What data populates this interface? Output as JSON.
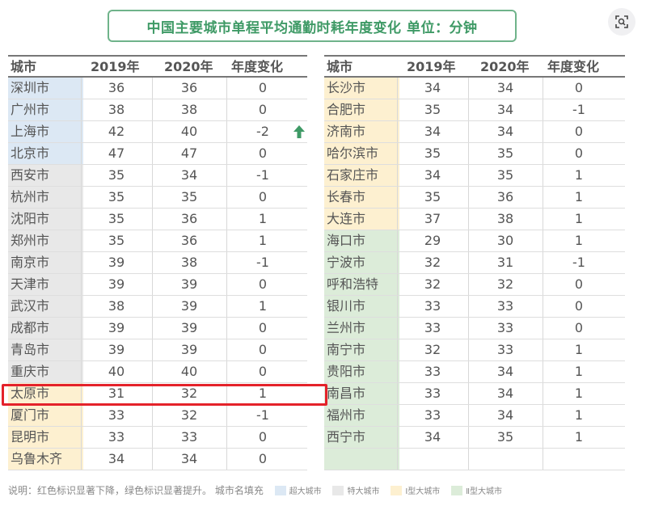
{
  "title": "中国主要城市单程平均通勤时耗年度变化  单位：分钟",
  "headers": [
    "城市",
    "2019年",
    "2020年",
    "年度变化"
  ],
  "colors": {
    "超大城市": "#dce8f4",
    "特大城市": "#e8e8e8",
    "I型大城市": "#fdf0d0",
    "II型大城市": "#dcecd9",
    "title_green": "#3f9a66",
    "highlight": "#e4222a",
    "arrow_green": "#3f9a66"
  },
  "left_table": [
    {
      "city": "深圳市",
      "y2019": "36",
      "y2020": "36",
      "change": "0",
      "tier": "超大城市"
    },
    {
      "city": "广州市",
      "y2019": "38",
      "y2020": "38",
      "change": "0",
      "tier": "超大城市"
    },
    {
      "city": "上海市",
      "y2019": "42",
      "y2020": "40",
      "change": "-2",
      "tier": "超大城市",
      "mark": "up-arrow-icon"
    },
    {
      "city": "北京市",
      "y2019": "47",
      "y2020": "47",
      "change": "0",
      "tier": "超大城市"
    },
    {
      "city": "西安市",
      "y2019": "35",
      "y2020": "34",
      "change": "-1",
      "tier": "特大城市"
    },
    {
      "city": "杭州市",
      "y2019": "35",
      "y2020": "35",
      "change": "0",
      "tier": "特大城市"
    },
    {
      "city": "沈阳市",
      "y2019": "35",
      "y2020": "36",
      "change": "1",
      "tier": "特大城市"
    },
    {
      "city": "郑州市",
      "y2019": "35",
      "y2020": "36",
      "change": "1",
      "tier": "特大城市"
    },
    {
      "city": "南京市",
      "y2019": "39",
      "y2020": "38",
      "change": "-1",
      "tier": "特大城市"
    },
    {
      "city": "天津市",
      "y2019": "39",
      "y2020": "39",
      "change": "0",
      "tier": "特大城市"
    },
    {
      "city": "武汉市",
      "y2019": "38",
      "y2020": "39",
      "change": "1",
      "tier": "特大城市"
    },
    {
      "city": "成都市",
      "y2019": "39",
      "y2020": "39",
      "change": "0",
      "tier": "特大城市"
    },
    {
      "city": "青岛市",
      "y2019": "39",
      "y2020": "39",
      "change": "0",
      "tier": "特大城市"
    },
    {
      "city": "重庆市",
      "y2019": "40",
      "y2020": "40",
      "change": "0",
      "tier": "特大城市"
    },
    {
      "city": "太原市",
      "y2019": "31",
      "y2020": "32",
      "change": "1",
      "tier": "I型大城市",
      "highlighted": true
    },
    {
      "city": "厦门市",
      "y2019": "33",
      "y2020": "32",
      "change": "-1",
      "tier": "I型大城市"
    },
    {
      "city": "昆明市",
      "y2019": "33",
      "y2020": "33",
      "change": "0",
      "tier": "I型大城市"
    },
    {
      "city": "乌鲁木齐",
      "y2019": "34",
      "y2020": "34",
      "change": "0",
      "tier": "I型大城市"
    }
  ],
  "right_table": [
    {
      "city": "长沙市",
      "y2019": "34",
      "y2020": "34",
      "change": "0",
      "tier": "I型大城市"
    },
    {
      "city": "合肥市",
      "y2019": "35",
      "y2020": "34",
      "change": "-1",
      "tier": "I型大城市"
    },
    {
      "city": "济南市",
      "y2019": "34",
      "y2020": "34",
      "change": "0",
      "tier": "I型大城市"
    },
    {
      "city": "哈尔滨市",
      "y2019": "35",
      "y2020": "35",
      "change": "0",
      "tier": "I型大城市"
    },
    {
      "city": "石家庄市",
      "y2019": "34",
      "y2020": "35",
      "change": "1",
      "tier": "I型大城市"
    },
    {
      "city": "长春市",
      "y2019": "35",
      "y2020": "36",
      "change": "1",
      "tier": "I型大城市"
    },
    {
      "city": "大连市",
      "y2019": "37",
      "y2020": "38",
      "change": "1",
      "tier": "I型大城市"
    },
    {
      "city": "海口市",
      "y2019": "29",
      "y2020": "30",
      "change": "1",
      "tier": "II型大城市"
    },
    {
      "city": "宁波市",
      "y2019": "32",
      "y2020": "31",
      "change": "-1",
      "tier": "II型大城市"
    },
    {
      "city": "呼和浩特",
      "y2019": "32",
      "y2020": "32",
      "change": "0",
      "tier": "II型大城市"
    },
    {
      "city": "银川市",
      "y2019": "33",
      "y2020": "33",
      "change": "0",
      "tier": "II型大城市"
    },
    {
      "city": "兰州市",
      "y2019": "33",
      "y2020": "33",
      "change": "0",
      "tier": "II型大城市"
    },
    {
      "city": "南宁市",
      "y2019": "32",
      "y2020": "33",
      "change": "1",
      "tier": "II型大城市"
    },
    {
      "city": "贵阳市",
      "y2019": "33",
      "y2020": "34",
      "change": "1",
      "tier": "II型大城市"
    },
    {
      "city": "南昌市",
      "y2019": "33",
      "y2020": "34",
      "change": "1",
      "tier": "II型大城市"
    },
    {
      "city": "福州市",
      "y2019": "33",
      "y2020": "34",
      "change": "1",
      "tier": "II型大城市"
    },
    {
      "city": "西宁市",
      "y2019": "34",
      "y2020": "35",
      "change": "1",
      "tier": "II型大城市"
    },
    {
      "city": "",
      "y2019": "",
      "y2020": "",
      "change": "",
      "tier": "II型大城市"
    }
  ],
  "legend": {
    "note": "说明：红色标识显著下降，绿色标识显著提升。  城市名填充",
    "items": [
      {
        "label": "超大城市",
        "tier": "超大城市"
      },
      {
        "label": "特大城市",
        "tier": "特大城市"
      },
      {
        "label": "Ⅰ型大城市",
        "tier": "I型大城市"
      },
      {
        "label": "Ⅱ型大城市",
        "tier": "II型大城市"
      }
    ]
  }
}
